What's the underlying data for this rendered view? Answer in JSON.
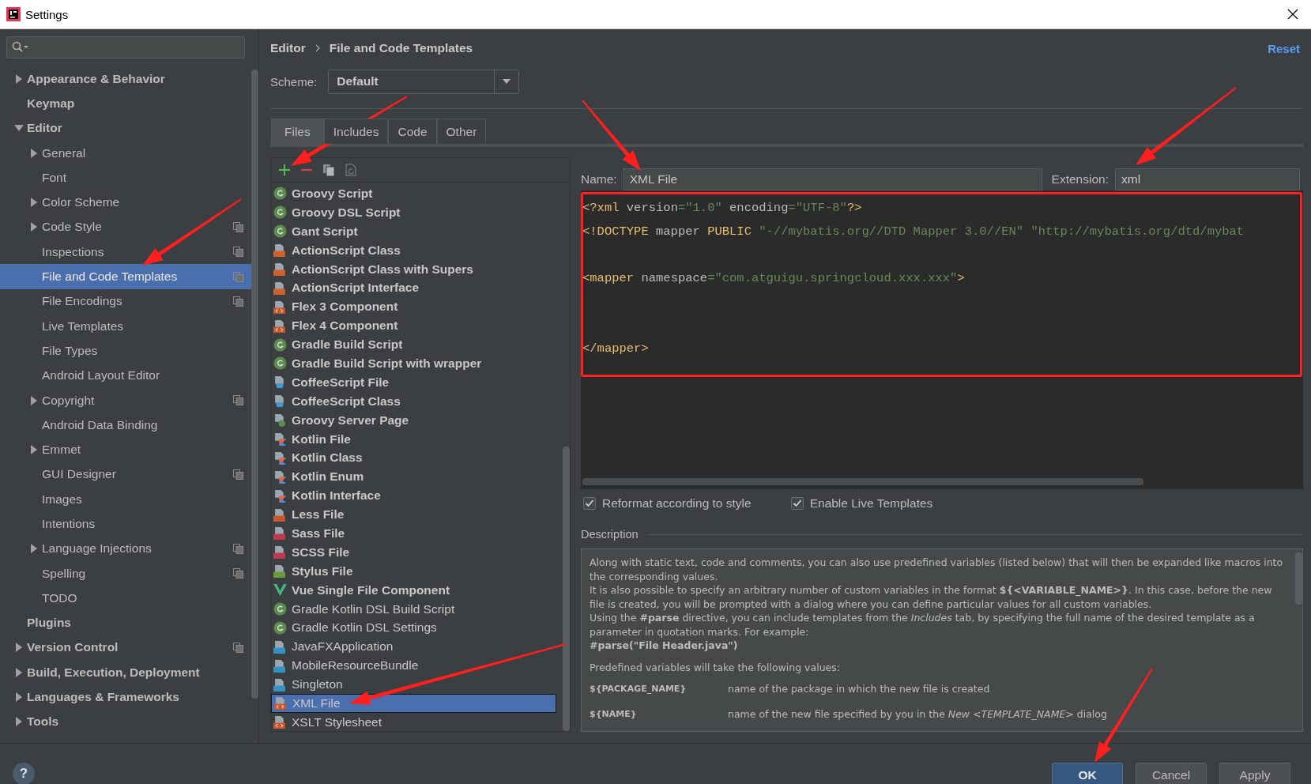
{
  "window": {
    "title": "Settings"
  },
  "sidebar": {
    "items": [
      {
        "label": "Appearance & Behavior",
        "expanded": false,
        "selected": false,
        "project_scope": false
      },
      {
        "label": "Keymap",
        "selected": false,
        "project_scope": false
      },
      {
        "label": "Editor",
        "expanded": true,
        "selected": false,
        "project_scope": false,
        "children": [
          {
            "label": "General",
            "expanded": false,
            "selected": false,
            "project_scope": false
          },
          {
            "label": "Font",
            "selected": false,
            "project_scope": false
          },
          {
            "label": "Color Scheme",
            "expanded": false,
            "selected": false,
            "project_scope": false
          },
          {
            "label": "Code Style",
            "expanded": false,
            "selected": false,
            "project_scope": true
          },
          {
            "label": "Inspections",
            "selected": false,
            "project_scope": true
          },
          {
            "label": "File and Code Templates",
            "selected": true,
            "project_scope": true
          },
          {
            "label": "File Encodings",
            "selected": false,
            "project_scope": true
          },
          {
            "label": "Live Templates",
            "selected": false,
            "project_scope": false
          },
          {
            "label": "File Types",
            "selected": false,
            "project_scope": false
          },
          {
            "label": "Android Layout Editor",
            "selected": false,
            "project_scope": false
          },
          {
            "label": "Copyright",
            "expanded": false,
            "selected": false,
            "project_scope": true
          },
          {
            "label": "Android Data Binding",
            "selected": false,
            "project_scope": false
          },
          {
            "label": "Emmet",
            "expanded": false,
            "selected": false,
            "project_scope": false
          },
          {
            "label": "GUI Designer",
            "selected": false,
            "project_scope": true
          },
          {
            "label": "Images",
            "selected": false,
            "project_scope": false
          },
          {
            "label": "Intentions",
            "selected": false,
            "project_scope": false
          },
          {
            "label": "Language Injections",
            "expanded": false,
            "selected": false,
            "project_scope": true
          },
          {
            "label": "Spelling",
            "selected": false,
            "project_scope": true
          },
          {
            "label": "TODO",
            "selected": false,
            "project_scope": false
          }
        ]
      },
      {
        "label": "Plugins",
        "selected": false,
        "project_scope": false
      },
      {
        "label": "Version Control",
        "expanded": false,
        "selected": false,
        "project_scope": true
      },
      {
        "label": "Build, Execution, Deployment",
        "expanded": false,
        "selected": false,
        "project_scope": false
      },
      {
        "label": "Languages & Frameworks",
        "expanded": false,
        "selected": false,
        "project_scope": false
      },
      {
        "label": "Tools",
        "expanded": false,
        "selected": false,
        "project_scope": false
      }
    ]
  },
  "breadcrumb": [
    "Editor",
    "File and Code Templates"
  ],
  "reset_link": "Reset",
  "scheme": {
    "label": "Scheme:",
    "value": "Default"
  },
  "tabs": [
    {
      "label": "Files",
      "selected": true
    },
    {
      "label": "Includes",
      "selected": false
    },
    {
      "label": "Code",
      "selected": false
    },
    {
      "label": "Other",
      "selected": false
    }
  ],
  "templates": [
    {
      "name": "Groovy Script",
      "kind": "groovy",
      "bold": true,
      "selected": false
    },
    {
      "name": "Groovy DSL Script",
      "kind": "groovy",
      "bold": true,
      "selected": false
    },
    {
      "name": "Gant Script",
      "kind": "groovy",
      "bold": true,
      "selected": false
    },
    {
      "name": "ActionScript Class",
      "kind": "actionscript",
      "bold": true,
      "selected": false
    },
    {
      "name": "ActionScript Class with Supers",
      "kind": "actionscript",
      "bold": true,
      "selected": false
    },
    {
      "name": "ActionScript Interface",
      "kind": "actionscript",
      "bold": true,
      "selected": false
    },
    {
      "name": "Flex 3 Component",
      "kind": "markup",
      "bold": true,
      "selected": false
    },
    {
      "name": "Flex 4 Component",
      "kind": "markup",
      "bold": true,
      "selected": false
    },
    {
      "name": "Gradle Build Script",
      "kind": "groovy",
      "bold": true,
      "selected": false
    },
    {
      "name": "Gradle Build Script with wrapper",
      "kind": "groovy",
      "bold": true,
      "selected": false
    },
    {
      "name": "CoffeeScript File",
      "kind": "coffee",
      "bold": true,
      "selected": false
    },
    {
      "name": "CoffeeScript Class",
      "kind": "coffee",
      "bold": true,
      "selected": false
    },
    {
      "name": "Groovy Server Page",
      "kind": "gsp",
      "bold": true,
      "selected": false
    },
    {
      "name": "Kotlin File",
      "kind": "kotlin",
      "bold": true,
      "selected": false
    },
    {
      "name": "Kotlin Class",
      "kind": "kotlin",
      "bold": true,
      "selected": false
    },
    {
      "name": "Kotlin Enum",
      "kind": "kotlin",
      "bold": true,
      "selected": false
    },
    {
      "name": "Kotlin Interface",
      "kind": "kotlin",
      "bold": true,
      "selected": false
    },
    {
      "name": "Less File",
      "kind": "less",
      "bold": true,
      "selected": false
    },
    {
      "name": "Sass File",
      "kind": "sass",
      "bold": true,
      "selected": false
    },
    {
      "name": "SCSS File",
      "kind": "sass",
      "bold": true,
      "selected": false
    },
    {
      "name": "Stylus File",
      "kind": "stylus",
      "bold": true,
      "selected": false
    },
    {
      "name": "Vue Single File Component",
      "kind": "vue",
      "bold": true,
      "selected": false
    },
    {
      "name": "Gradle Kotlin DSL Build Script",
      "kind": "groovy",
      "bold": false,
      "selected": false
    },
    {
      "name": "Gradle Kotlin DSL Settings",
      "kind": "groovy",
      "bold": false,
      "selected": false
    },
    {
      "name": "JavaFXApplication",
      "kind": "java",
      "bold": false,
      "selected": false
    },
    {
      "name": "MobileResourceBundle",
      "kind": "java",
      "bold": false,
      "selected": false
    },
    {
      "name": "Singleton",
      "kind": "java",
      "bold": false,
      "selected": false
    },
    {
      "name": "XML File",
      "kind": "markup",
      "bold": false,
      "selected": true
    },
    {
      "name": "XSLT Stylesheet",
      "kind": "markup",
      "bold": false,
      "selected": false
    }
  ],
  "name_field": {
    "label": "Name:",
    "value": "XML File"
  },
  "extension_field": {
    "label": "Extension:",
    "value": "xml"
  },
  "code_lines": [
    {
      "kind": "code",
      "tokens": [
        {
          "kind": "tag",
          "text": "<?xml"
        },
        {
          "kind": "attr",
          "text": " version"
        },
        {
          "kind": "value",
          "text": "=\"1.0\""
        },
        {
          "kind": "attr",
          "text": " encoding"
        },
        {
          "kind": "value",
          "text": "=\"UTF-8\""
        },
        {
          "kind": "tag",
          "text": "?>"
        }
      ]
    },
    {
      "kind": "code",
      "tokens": [
        {
          "kind": "tag",
          "text": "<!DOCTYPE"
        },
        {
          "kind": "attr",
          "text": " mapper "
        },
        {
          "kind": "tag",
          "text": "PUBLIC"
        },
        {
          "kind": "value",
          "text": " \"-//mybatis.org//DTD Mapper 3.0//EN\" \"http://mybatis.org/dtd/mybat"
        }
      ]
    },
    {
      "kind": "blank"
    },
    {
      "kind": "code",
      "tokens": [
        {
          "kind": "tag",
          "text": "<mapper"
        },
        {
          "kind": "attr",
          "text": " namespace"
        },
        {
          "kind": "value",
          "text": "=\"com.atguigu.springcloud.xxx.xxx\""
        },
        {
          "kind": "tag",
          "text": ">"
        }
      ]
    },
    {
      "kind": "blank"
    },
    {
      "kind": "blank"
    },
    {
      "kind": "code",
      "tokens": [
        {
          "kind": "tag",
          "text": "</mapper>"
        }
      ]
    }
  ],
  "options": [
    {
      "label": "Reformat according to style",
      "checked": true
    },
    {
      "label": "Enable Live Templates",
      "checked": true
    }
  ],
  "description": {
    "title": "Description",
    "paragraphs": [
      "Along with static text, code and comments, you can also use predefined variables (listed below) that will then be expanded like macros into the corresponding values.",
      "It is also possible to specify an arbitrary number of custom variables in the format **${<VARIABLE_NAME>}**. In this case, before the new file is created, you will be prompted with a dialog where you can define particular values for all custom variables.",
      "Using the **#parse** directive, you can include templates from the *Includes* tab, by specifying the full name of the desired template as a parameter in quotation marks. For example:",
      "**#parse(\"File Header.java\")**"
    ],
    "variables_intro": "Predefined variables will take the following values:",
    "variables": [
      {
        "name": "${PACKAGE_NAME}",
        "text": "name of the package in which the new file is created"
      },
      {
        "name": "${NAME}",
        "text": "name of the new file specified by you in the *New <TEMPLATE_NAME>* dialog"
      }
    ]
  },
  "help_button": "?",
  "buttons": [
    {
      "label": "OK",
      "kind": "primary"
    },
    {
      "label": "Cancel",
      "kind": "normal"
    },
    {
      "label": "Apply",
      "kind": "normal"
    }
  ]
}
